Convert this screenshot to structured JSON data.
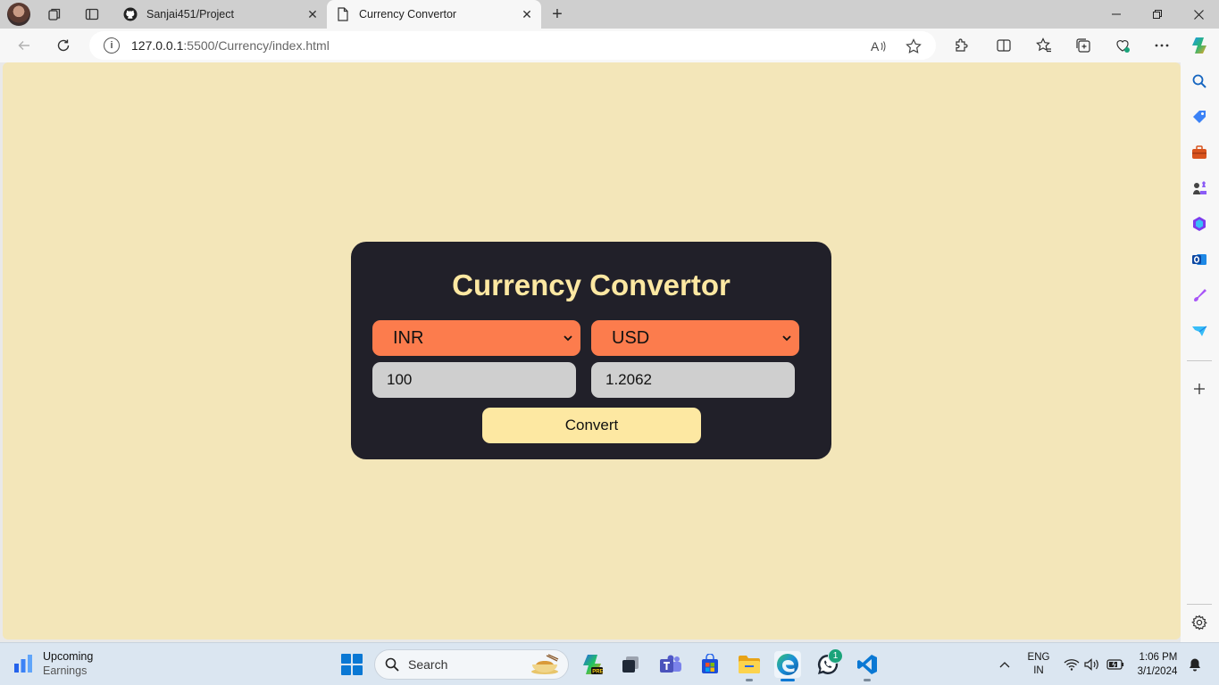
{
  "browser": {
    "tabs": [
      {
        "title": "Sanjai451/Project",
        "active": false
      },
      {
        "title": "Currency Convertor",
        "active": true
      }
    ],
    "url_host": "127.0.0.1",
    "url_path": ":5500/Currency/index.html"
  },
  "page": {
    "heading": "Currency Convertor",
    "from_currency": "INR",
    "to_currency": "USD",
    "amount": "100",
    "result": "1.2062",
    "convert_label": "Convert",
    "colors": {
      "background": "#f3e6b9",
      "card": "#212029",
      "heading": "#fde8a2",
      "select": "#fc7c4d",
      "input": "#cfcfcf",
      "button": "#fde8a2"
    }
  },
  "taskbar": {
    "widget_title": "Upcoming",
    "widget_subtitle": "Earnings",
    "search_label": "Search",
    "whatsapp_badge": "1",
    "lang_top": "ENG",
    "lang_bottom": "IN",
    "time": "1:06 PM",
    "date": "3/1/2024"
  }
}
